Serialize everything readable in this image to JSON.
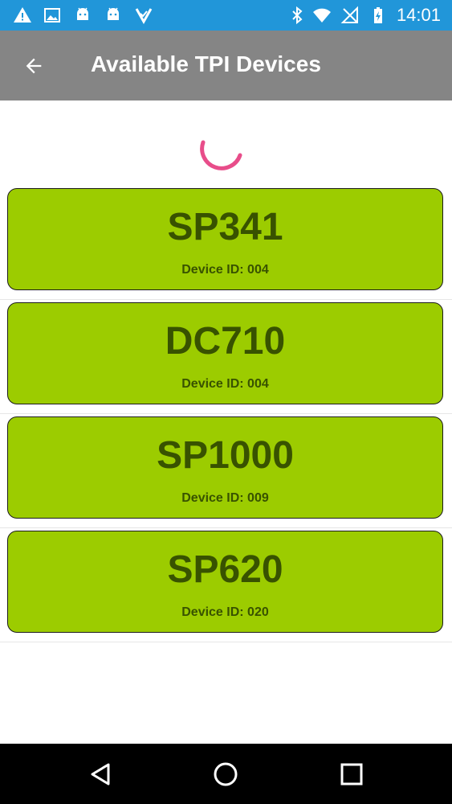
{
  "status_bar": {
    "time": "14:01",
    "left_icons": [
      "warning-icon",
      "image-icon",
      "android-icon",
      "android-icon",
      "app-check-icon"
    ],
    "right_icons": [
      "bluetooth-icon",
      "wifi-icon",
      "no-signal-icon",
      "battery-charging-icon"
    ]
  },
  "app_bar": {
    "title": "Available TPI Devices",
    "back_icon": "arrow-back-icon"
  },
  "loading": {
    "indicator": "spinner",
    "color": "#e84d8a"
  },
  "devices": [
    {
      "name": "SP341",
      "device_id": "Device ID: 004"
    },
    {
      "name": "DC710",
      "device_id": "Device ID: 004"
    },
    {
      "name": "SP1000",
      "device_id": "Device ID: 009"
    },
    {
      "name": "SP620",
      "device_id": "Device ID: 020"
    }
  ],
  "nav_bar": {
    "buttons": [
      "back-triangle-icon",
      "home-circle-icon",
      "recents-square-icon"
    ]
  },
  "colors": {
    "status_bar": "#2196d9",
    "app_bar": "#858585",
    "card_bg": "#9ccc00",
    "card_text": "#385200"
  }
}
